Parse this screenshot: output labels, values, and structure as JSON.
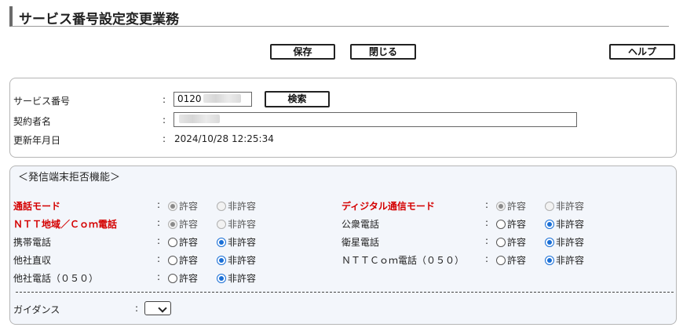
{
  "page": {
    "title": "サービス番号設定変更業務"
  },
  "toolbar": {
    "save": "保存",
    "close": "閉じる",
    "help": "ヘルプ"
  },
  "info": {
    "service_no_label": "サービス番号",
    "service_no_value": "0120",
    "search_button": "検索",
    "contractor_label": "契約者名",
    "contractor_value": "",
    "updated_label": "更新年月日",
    "updated_value": "2024/10/28 12:25:34",
    "colon": ":"
  },
  "section": {
    "title": "＜発信端末拒否機能＞",
    "allow": "許容",
    "deny": "非許容",
    "left_rows": [
      {
        "label": "通話モード",
        "red": true,
        "selected": "allow",
        "disabled": true
      },
      {
        "label": "ＮＴＴ地域／Ｃｏｍ電話",
        "red": true,
        "selected": "allow",
        "disabled": true
      },
      {
        "label": "携帯電話",
        "red": false,
        "selected": "deny",
        "disabled": false
      },
      {
        "label": "他社直収",
        "red": false,
        "selected": "deny",
        "disabled": false
      },
      {
        "label": "他社電話（０５０）",
        "red": false,
        "selected": "deny",
        "disabled": false
      }
    ],
    "right_rows": [
      {
        "label": "ディジタル通信モード",
        "red": true,
        "selected": "allow",
        "disabled": true
      },
      {
        "label": "公衆電話",
        "red": false,
        "selected": "deny",
        "disabled": false
      },
      {
        "label": "衛星電話",
        "red": false,
        "selected": "deny",
        "disabled": false
      },
      {
        "label": "ＮＴＴＣｏｍ電話（０５０）",
        "red": false,
        "selected": "deny",
        "disabled": false
      }
    ],
    "guidance_label": "ガイダンス",
    "guidance_value": ""
  }
}
